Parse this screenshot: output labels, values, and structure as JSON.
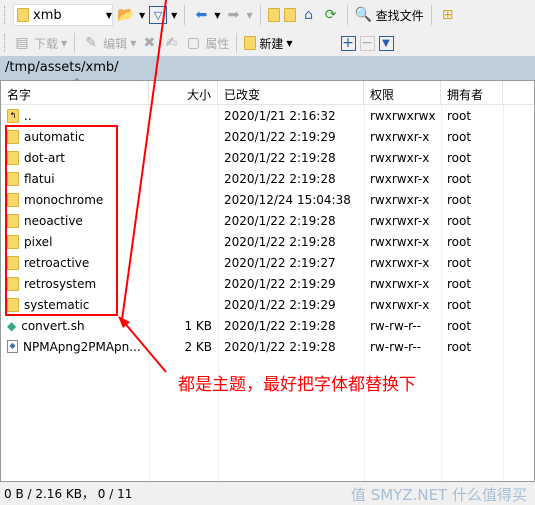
{
  "toolbar1": {
    "location": "xmb",
    "find_label": "查找文件"
  },
  "toolbar2": {
    "download": "下载",
    "edit": "编辑",
    "properties": "属性",
    "new": "新建"
  },
  "path": "/tmp/assets/xmb/",
  "columns": [
    "名字",
    "大小",
    "已改变",
    "权限",
    "拥有者"
  ],
  "rows": [
    {
      "name": "..",
      "size": "",
      "modified": "2020/1/21 2:16:32",
      "perms": "rwxrwxrwx",
      "owner": "root",
      "type": "up"
    },
    {
      "name": "automatic",
      "size": "",
      "modified": "2020/1/22 2:19:29",
      "perms": "rwxrwxr-x",
      "owner": "root",
      "type": "folder"
    },
    {
      "name": "dot-art",
      "size": "",
      "modified": "2020/1/22 2:19:28",
      "perms": "rwxrwxr-x",
      "owner": "root",
      "type": "folder"
    },
    {
      "name": "flatui",
      "size": "",
      "modified": "2020/1/22 2:19:28",
      "perms": "rwxrwxr-x",
      "owner": "root",
      "type": "folder"
    },
    {
      "name": "monochrome",
      "size": "",
      "modified": "2020/12/24 15:04:38",
      "perms": "rwxrwxr-x",
      "owner": "root",
      "type": "folder"
    },
    {
      "name": "neoactive",
      "size": "",
      "modified": "2020/1/22 2:19:28",
      "perms": "rwxrwxr-x",
      "owner": "root",
      "type": "folder"
    },
    {
      "name": "pixel",
      "size": "",
      "modified": "2020/1/22 2:19:28",
      "perms": "rwxrwxr-x",
      "owner": "root",
      "type": "folder"
    },
    {
      "name": "retroactive",
      "size": "",
      "modified": "2020/1/22 2:19:27",
      "perms": "rwxrwxr-x",
      "owner": "root",
      "type": "folder"
    },
    {
      "name": "retrosystem",
      "size": "",
      "modified": "2020/1/22 2:19:29",
      "perms": "rwxrwxr-x",
      "owner": "root",
      "type": "folder"
    },
    {
      "name": "systematic",
      "size": "",
      "modified": "2020/1/22 2:19:29",
      "perms": "rwxrwxr-x",
      "owner": "root",
      "type": "folder"
    },
    {
      "name": "convert.sh",
      "size": "1 KB",
      "modified": "2020/1/22 2:19:28",
      "perms": "rw-rw-r--",
      "owner": "root",
      "type": "script"
    },
    {
      "name": "NPMApng2PMApn...",
      "size": "2 KB",
      "modified": "2020/1/22 2:19:28",
      "perms": "rw-rw-r--",
      "owner": "root",
      "type": "file"
    }
  ],
  "annotation": "都是主题，最好把字体都替换下",
  "status": "0 B / 2.16 KB， 0 / 11",
  "watermark": "值 SMYZ.NET 什么值得买"
}
